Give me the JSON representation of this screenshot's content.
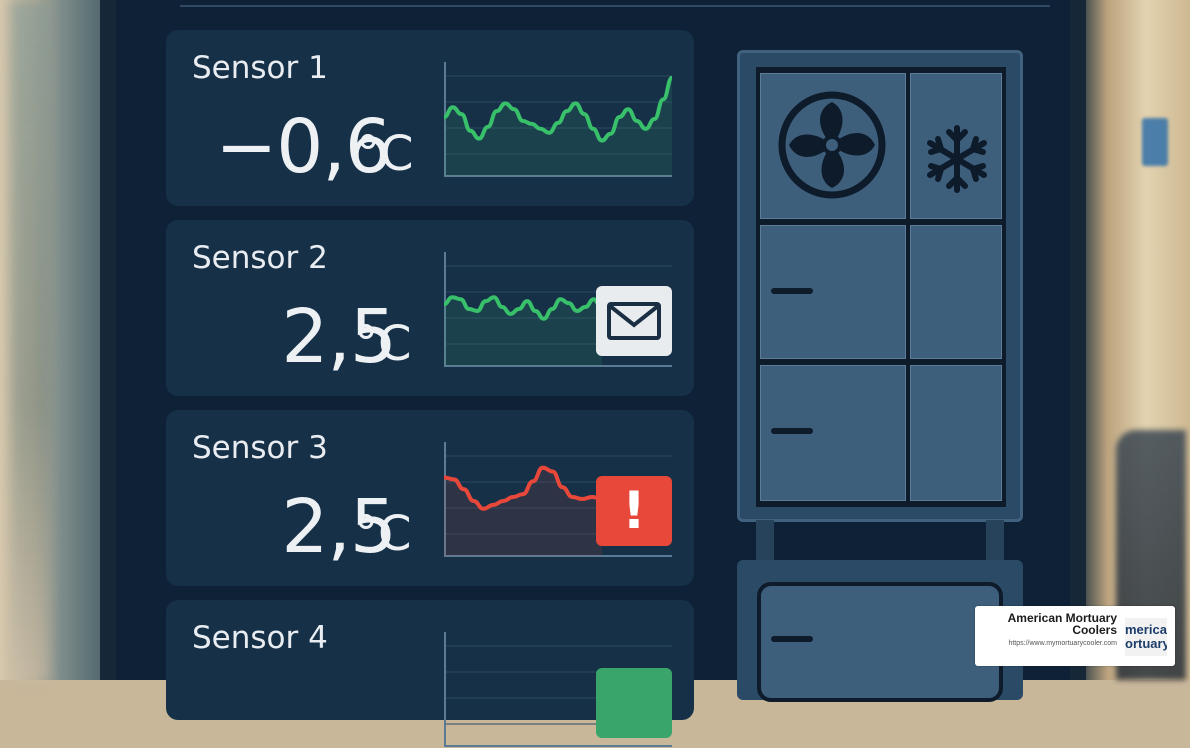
{
  "sensors": [
    {
      "label": "Sensor 1",
      "value": "−0,6",
      "unit": "°C",
      "status": "normal",
      "line_color": "#39c06a",
      "trend": [
        0.52,
        0.62,
        0.55,
        0.38,
        0.3,
        0.42,
        0.58,
        0.66,
        0.6,
        0.48,
        0.45,
        0.4,
        0.36,
        0.46,
        0.58,
        0.66,
        0.55,
        0.4,
        0.28,
        0.35,
        0.52,
        0.6,
        0.48,
        0.4,
        0.5,
        0.7,
        0.92
      ]
    },
    {
      "label": "Sensor 2",
      "value": "2,5",
      "unit": "°C",
      "status": "message",
      "badge_icon": "envelope-icon",
      "line_color": "#39c06a",
      "trend": [
        0.55,
        0.62,
        0.6,
        0.5,
        0.48,
        0.58,
        0.62,
        0.52,
        0.45,
        0.5,
        0.58,
        0.48,
        0.4,
        0.5,
        0.6,
        0.56,
        0.48,
        0.52,
        0.6,
        0.5
      ]
    },
    {
      "label": "Sensor 3",
      "value": "2,5",
      "unit": "°C",
      "status": "alert",
      "badge_icon": "exclamation-icon",
      "badge_text": "!",
      "line_color": "#e7483a",
      "trend": [
        0.72,
        0.7,
        0.6,
        0.48,
        0.4,
        0.44,
        0.48,
        0.52,
        0.55,
        0.68,
        0.82,
        0.78,
        0.62,
        0.52,
        0.5,
        0.52,
        0.5
      ]
    },
    {
      "label": "Sensor 4",
      "status": "ok",
      "line_color": "#39c06a"
    }
  ],
  "cooler": {
    "icons": [
      "fan-icon",
      "snowflake-icon"
    ]
  },
  "watermark": {
    "name": "American Mortuary Coolers",
    "url": "https://www.mymortuarycooler.com",
    "logo_text": "merican ortuary"
  }
}
